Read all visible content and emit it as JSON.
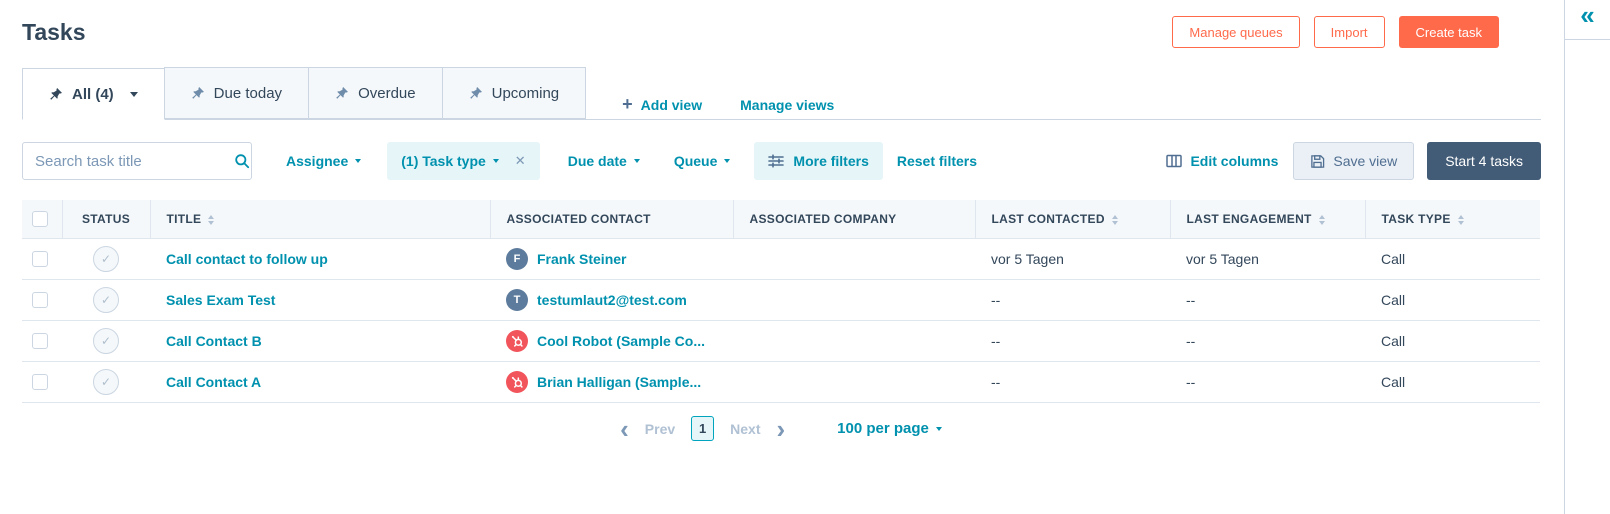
{
  "page_title": "Tasks",
  "header": {
    "manage_queues": "Manage queues",
    "import": "Import",
    "create_task": "Create task"
  },
  "tabs": [
    {
      "label": "All (4)",
      "active": true
    },
    {
      "label": "Due today",
      "active": false
    },
    {
      "label": "Overdue",
      "active": false
    },
    {
      "label": "Upcoming",
      "active": false
    }
  ],
  "views": {
    "add_view_icon": "+",
    "add_view": "Add view",
    "manage_views": "Manage views"
  },
  "filters": {
    "search_placeholder": "Search task title",
    "assignee": "Assignee",
    "task_type": "(1) Task type",
    "close_icon": "✕",
    "due_date": "Due date",
    "queue": "Queue",
    "more_filters": "More filters",
    "reset_filters": "Reset filters"
  },
  "actions": {
    "edit_columns": "Edit columns",
    "save_view": "Save view",
    "start_tasks": "Start 4 tasks"
  },
  "table": {
    "columns": [
      {
        "label": "STATUS"
      },
      {
        "label": "TITLE"
      },
      {
        "label": "ASSOCIATED CONTACT"
      },
      {
        "label": "ASSOCIATED COMPANY"
      },
      {
        "label": "LAST CONTACTED"
      },
      {
        "label": "LAST ENGAGEMENT"
      },
      {
        "label": "TASK TYPE"
      }
    ],
    "rows": [
      {
        "title": "Call contact to follow up",
        "contact": "Frank Steiner",
        "avatar_letter": "F",
        "company": "",
        "last_contacted": "vor 5 Tagen",
        "last_engagement": "vor 5 Tagen",
        "task_type": "Call"
      },
      {
        "title": "Sales Exam Test",
        "contact": "testumlaut2@test.com",
        "avatar_letter": "T",
        "company": "",
        "last_contacted": "--",
        "last_engagement": "--",
        "task_type": "Call"
      },
      {
        "title": "Call Contact B",
        "contact": "Cool Robot (Sample Co...",
        "avatar_letter": "",
        "company": "",
        "last_contacted": "--",
        "last_engagement": "--",
        "task_type": "Call"
      },
      {
        "title": "Call Contact A",
        "contact": "Brian Halligan (Sample...",
        "avatar_letter": "",
        "company": "",
        "last_contacted": "--",
        "last_engagement": "--",
        "task_type": "Call"
      }
    ]
  },
  "pagination": {
    "prev_icon": "‹",
    "prev": "Prev",
    "page": "1",
    "next": "Next",
    "next_icon": "›",
    "per_page": "100 per page"
  },
  "sidebar": {
    "collapse_icon": "«"
  },
  "icons": [
    "pin-icon",
    "search-icon",
    "close-icon",
    "sliders-icon",
    "columns-icon",
    "save-icon",
    "sort-icon",
    "caret-down-icon",
    "hubspot-sprocket-icon",
    "chevron-left-icon",
    "chevron-right-icon",
    "collapse-double-chevron-icon",
    "plus-icon"
  ],
  "colors": {
    "accent_orange": "#ff6a4b",
    "teal_link": "#0091ae",
    "navy_text": "#33475b",
    "dark_button": "#425b76",
    "avatar_slate": "#5d7b9c",
    "avatar_orange": "#f2545b",
    "pill_blue": "#e5f5f8"
  }
}
